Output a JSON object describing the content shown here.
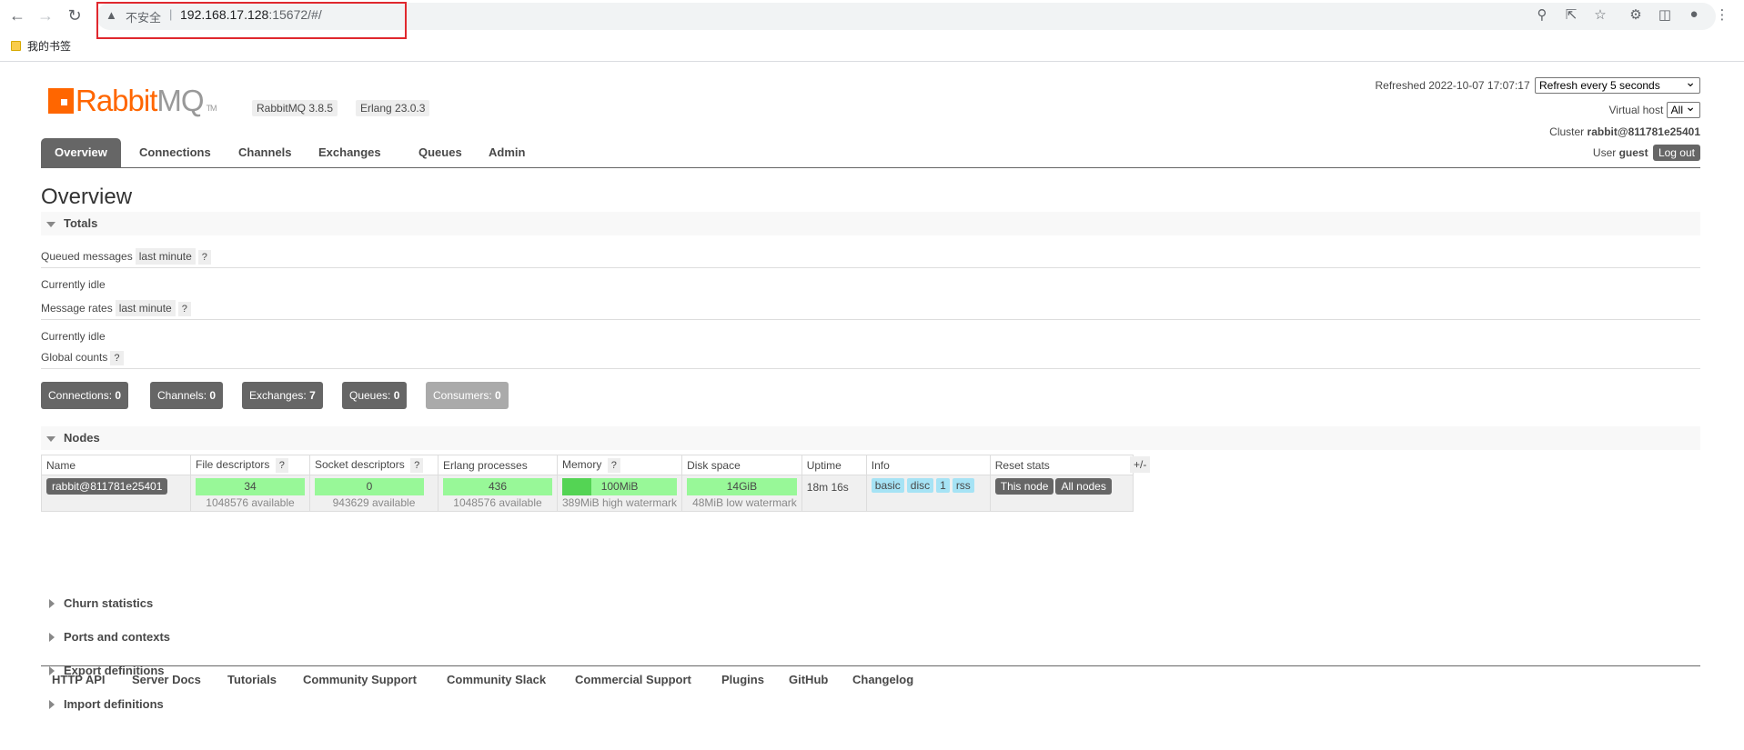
{
  "browser": {
    "insecure_label": "不安全",
    "url_host": "192.168.17.128",
    "url_rest": ":15672/#/",
    "bookmark_label": "我的书签"
  },
  "header": {
    "logo_rabbit": "Rabbit",
    "logo_mq": "MQ",
    "logo_tm": "TM",
    "version_rabbitmq": "RabbitMQ 3.8.5",
    "version_erlang": "Erlang 23.0.3",
    "refreshed_label": "Refreshed",
    "refreshed_time": "2022-10-07 17:07:17",
    "refresh_option": "Refresh every 5 seconds",
    "vhost_label": "Virtual host",
    "vhost_value": "All",
    "cluster_label": "Cluster",
    "cluster_name": "rabbit@811781e25401",
    "user_label": "User",
    "user_name": "guest",
    "logout_label": "Log out"
  },
  "tabs": [
    "Overview",
    "Connections",
    "Channels",
    "Exchanges",
    "Queues",
    "Admin"
  ],
  "page_title": "Overview",
  "totals": {
    "heading": "Totals",
    "queued_label": "Queued messages",
    "queued_range": "last minute",
    "help": "?",
    "queued_status": "Currently idle",
    "rates_label": "Message rates",
    "rates_range": "last minute",
    "rates_status": "Currently idle",
    "global_label": "Global counts"
  },
  "counts": [
    {
      "label": "Connections:",
      "value": "0"
    },
    {
      "label": "Channels:",
      "value": "0"
    },
    {
      "label": "Exchanges:",
      "value": "7"
    },
    {
      "label": "Queues:",
      "value": "0"
    },
    {
      "label": "Consumers:",
      "value": "0"
    }
  ],
  "nodes": {
    "heading": "Nodes",
    "columns": [
      "Name",
      "File descriptors",
      "Socket descriptors",
      "Erlang processes",
      "Memory",
      "Disk space",
      "Uptime",
      "Info",
      "Reset stats"
    ],
    "toggle": "+/-",
    "row": {
      "name": "rabbit@811781e25401",
      "fd_used": "34",
      "fd_available": "1048576 available",
      "sd_used": "0",
      "sd_available": "943629 available",
      "erl_used": "436",
      "erl_available": "1048576 available",
      "memory": "100MiB",
      "memory_fraction": 0.257,
      "memory_sub": "389MiB high watermark",
      "disk": "14GiB",
      "disk_sub": "48MiB low watermark",
      "uptime": "18m 16s",
      "info_tags": [
        "basic",
        "disc",
        "1",
        "rss"
      ],
      "reset_this": "This node",
      "reset_all": "All nodes"
    }
  },
  "collapsed_sections": [
    "Churn statistics",
    "Ports and contexts",
    "Export definitions",
    "Import definitions"
  ],
  "footer_links": [
    "HTTP API",
    "Server Docs",
    "Tutorials",
    "Community Support",
    "Community Slack",
    "Commercial Support",
    "Plugins",
    "GitHub",
    "Changelog"
  ]
}
